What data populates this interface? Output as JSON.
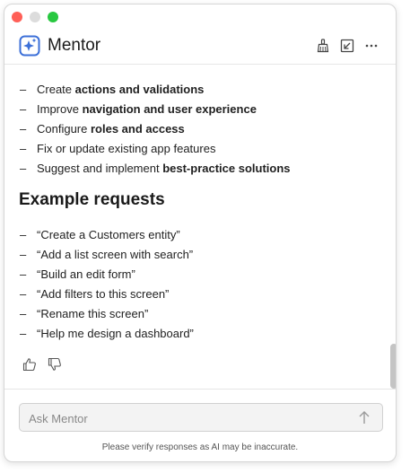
{
  "app": {
    "title": "Mentor"
  },
  "capabilities": [
    {
      "prefix": "Create ",
      "bold": "actions and validations",
      "suffix": ""
    },
    {
      "prefix": "Improve ",
      "bold": "navigation and user experience",
      "suffix": ""
    },
    {
      "prefix": "Configure ",
      "bold": "roles and access",
      "suffix": ""
    },
    {
      "prefix": "Fix or update existing app features",
      "bold": "",
      "suffix": ""
    },
    {
      "prefix": "Suggest and implement ",
      "bold": "best-practice solutions",
      "suffix": ""
    }
  ],
  "example_section": {
    "title": "Example requests",
    "items": [
      "“Create a Customers entity”",
      "“Add a list screen with search”",
      "“Build an edit form”",
      "“Add filters to this screen”",
      "“Rename this screen”",
      "“Help me design a dashboard”"
    ]
  },
  "dash": "–",
  "composer": {
    "placeholder": "Ask Mentor",
    "value": ""
  },
  "disclaimer": "Please verify responses as AI may be inaccurate.",
  "colors": {
    "brand": "#3b6fd8",
    "close": "#ff5f57",
    "zoom": "#28c840"
  },
  "icons": {
    "brand": "sparkle-icon",
    "clear": "broom-icon",
    "collapse": "collapse-icon",
    "more": "more-icon",
    "like": "thumbs-up-icon",
    "dislike": "thumbs-down-icon",
    "send": "arrow-up-icon"
  }
}
